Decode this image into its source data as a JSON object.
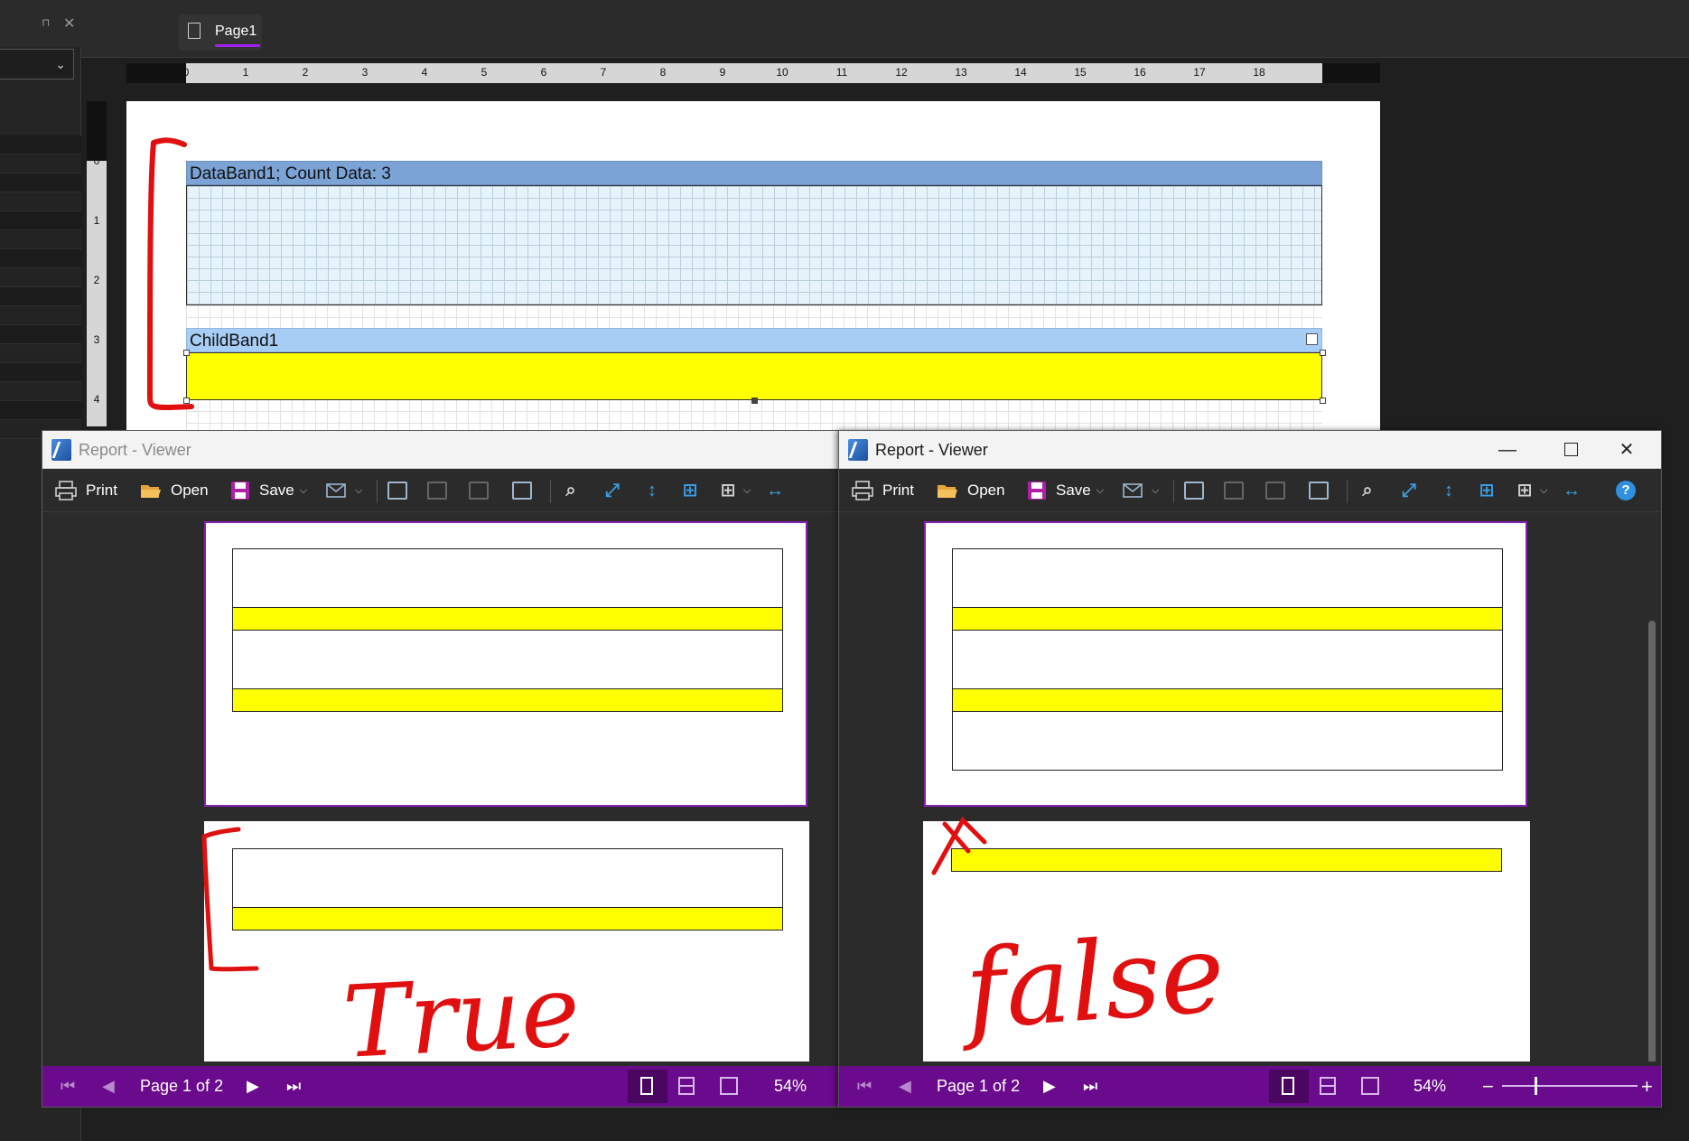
{
  "designer": {
    "tab_label": "Page1",
    "ruler_numbers": [
      "0",
      "1",
      "2",
      "3",
      "4",
      "5",
      "6",
      "7",
      "8",
      "9",
      "10",
      "11",
      "12",
      "13",
      "14",
      "15",
      "16",
      "17",
      "18"
    ],
    "vruler_numbers": [
      "0",
      "1",
      "2",
      "3",
      "4"
    ],
    "databand_label": "DataBand1; Count Data: 3",
    "childband_label": "ChildBand1"
  },
  "viewers": [
    {
      "title": "Report - Viewer",
      "toolbar": {
        "print": "Print",
        "open": "Open",
        "save": "Save"
      },
      "status": {
        "page_text": "Page 1 of 2",
        "zoom": "54%"
      }
    },
    {
      "title": "Report - Viewer",
      "toolbar": {
        "print": "Print",
        "open": "Open",
        "save": "Save"
      },
      "status": {
        "page_text": "Page 1 of 2",
        "zoom": "54%"
      }
    }
  ],
  "annotations": {
    "left_text": "True",
    "right_text": "false",
    "right_mark": "X"
  },
  "colors": {
    "accent_purple": "#6a0a8c",
    "band_yellow": "#ffff00",
    "databand_header": "#7ba3d6",
    "childband_header": "#a8cdf5",
    "annotation_red": "#e01010"
  }
}
